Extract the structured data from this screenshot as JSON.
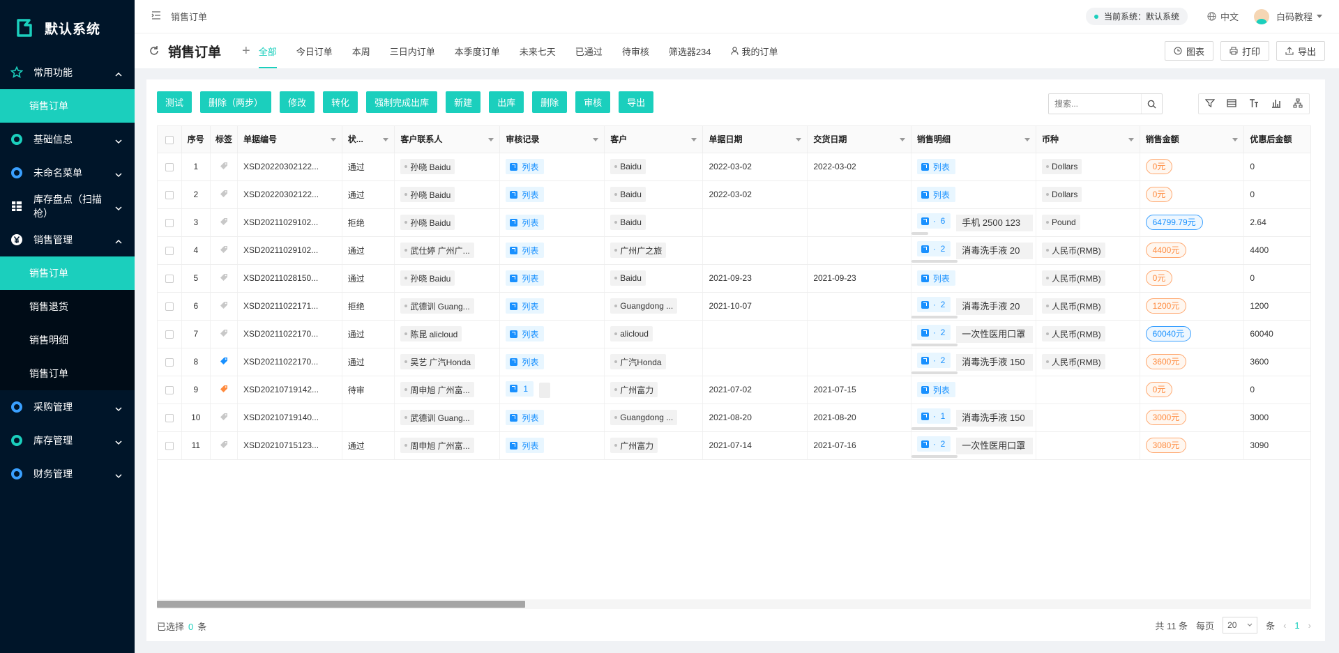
{
  "app": {
    "logo_text": "默认系统",
    "accent": "#1bcfbd",
    "sidebar_bg": "#001529"
  },
  "sidebar": {
    "items": [
      {
        "label": "常用功能",
        "type": "group",
        "icon": "star-icon",
        "expanded": true
      },
      {
        "label": "销售订单",
        "type": "sub",
        "active": true
      },
      {
        "label": "基础信息",
        "type": "group",
        "icon": "ring-icon",
        "expanded": false
      },
      {
        "label": "未命名菜单",
        "type": "group",
        "icon": "ring-icon",
        "expanded": false
      },
      {
        "label": "库存盘点（扫描枪）",
        "type": "group",
        "icon": "grid-icon",
        "expanded": false
      },
      {
        "label": "销售管理",
        "type": "group",
        "icon": "yen-icon",
        "expanded": true
      },
      {
        "label": "销售订单",
        "type": "sub",
        "active": true
      },
      {
        "label": "销售退货",
        "type": "sub",
        "active": false
      },
      {
        "label": "销售明细",
        "type": "sub",
        "active": false
      },
      {
        "label": "销售订单",
        "type": "sub",
        "active": false
      },
      {
        "label": "采购管理",
        "type": "group",
        "icon": "ring-icon",
        "expanded": false
      },
      {
        "label": "库存管理",
        "type": "group",
        "icon": "ring-icon",
        "expanded": false
      },
      {
        "label": "财务管理",
        "type": "group",
        "icon": "ring-icon",
        "expanded": false
      }
    ]
  },
  "topbar": {
    "breadcrumb": "销售订单",
    "current_system": "当前系统：默认系统",
    "language": "中文",
    "user": "白码教程"
  },
  "page": {
    "title": "销售订单",
    "tabs": [
      "全部",
      "今日订单",
      "本周",
      "三日内订单",
      "本季度订单",
      "未来七天",
      "已通过",
      "待审核",
      "筛选器234",
      "我的订单"
    ],
    "active_tab": 0,
    "right_buttons": [
      "图表",
      "打印",
      "导出"
    ]
  },
  "toolbar": {
    "buttons": [
      "测试",
      "删除（两步）",
      "修改",
      "转化",
      "强制完成出库",
      "新建",
      "出库",
      "删除",
      "审核",
      "导出"
    ],
    "search_placeholder": "搜索..."
  },
  "table": {
    "columns": [
      "序号",
      "标签",
      "单据编号",
      "状...",
      "客户联系人",
      "审核记录",
      "客户",
      "单据日期",
      "交货日期",
      "销售明细",
      "币种",
      "销售金额",
      "优惠后金额"
    ],
    "rows": [
      {
        "no": "1",
        "tag": "grey",
        "code": "XSD20220302122...",
        "status": "通过",
        "contact": "孙晓 Baidu",
        "audit": "列表",
        "audit_count": "",
        "customer": "Baidu",
        "date": "2022-03-02",
        "delivery": "2022-03-02",
        "detail_count": "",
        "detail_text": "",
        "currency": "Dollars",
        "amount": "0元",
        "amount_style": "orange",
        "discount": "0"
      },
      {
        "no": "2",
        "tag": "grey",
        "code": "XSD20220302122...",
        "status": "通过",
        "contact": "孙晓 Baidu",
        "audit": "列表",
        "audit_count": "",
        "customer": "Baidu",
        "date": "2022-03-02",
        "delivery": "",
        "detail_count": "",
        "detail_text": "",
        "currency": "Dollars",
        "amount": "0元",
        "amount_style": "orange",
        "discount": "0"
      },
      {
        "no": "3",
        "tag": "grey",
        "code": "XSD20211029102...",
        "status": "拒绝",
        "contact": "孙晓 Baidu",
        "audit": "列表",
        "audit_count": "",
        "customer": "Baidu",
        "date": "",
        "delivery": "",
        "detail_count": "6",
        "detail_text": "手机 2500 123",
        "currency": "Pound",
        "amount": "64799.79元",
        "amount_style": "blue",
        "discount": "2.64"
      },
      {
        "no": "4",
        "tag": "grey",
        "code": "XSD20211029102...",
        "status": "通过",
        "contact": "武仕婷 广州广...",
        "audit": "列表",
        "audit_count": "",
        "customer": "广州广之旅",
        "date": "",
        "delivery": "",
        "detail_count": "2",
        "detail_text": "消毒洗手液 20",
        "currency": "人民币(RMB)",
        "amount": "4400元",
        "amount_style": "orange",
        "discount": "4400"
      },
      {
        "no": "5",
        "tag": "grey",
        "code": "XSD20211028150...",
        "status": "通过",
        "contact": "孙晓 Baidu",
        "audit": "列表",
        "audit_count": "",
        "customer": "Baidu",
        "date": "2021-09-23",
        "delivery": "2021-09-23",
        "detail_count": "",
        "detail_text": "",
        "currency": "人民币(RMB)",
        "amount": "0元",
        "amount_style": "orange",
        "discount": "0"
      },
      {
        "no": "6",
        "tag": "grey",
        "code": "XSD20211022171...",
        "status": "拒绝",
        "contact": "武德训 Guang...",
        "audit": "列表",
        "audit_count": "",
        "customer": "Guangdong ...",
        "date": "2021-10-07",
        "delivery": "",
        "detail_count": "2",
        "detail_text": "消毒洗手液 20",
        "currency": "人民币(RMB)",
        "amount": "1200元",
        "amount_style": "orange",
        "discount": "1200"
      },
      {
        "no": "7",
        "tag": "grey",
        "code": "XSD20211022170...",
        "status": "通过",
        "contact": "陈昆 alicloud",
        "audit": "列表",
        "audit_count": "",
        "customer": "alicloud",
        "date": "",
        "delivery": "",
        "detail_count": "2",
        "detail_text": "一次性医用口罩",
        "currency": "人民币(RMB)",
        "amount": "60040元",
        "amount_style": "blue",
        "discount": "60040"
      },
      {
        "no": "8",
        "tag": "blue",
        "code": "XSD20211022170...",
        "status": "通过",
        "contact": "吴艺 广汽Honda",
        "audit": "列表",
        "audit_count": "",
        "customer": "广汽Honda",
        "date": "",
        "delivery": "",
        "detail_count": "2",
        "detail_text": "消毒洗手液 150",
        "currency": "人民币(RMB)",
        "amount": "3600元",
        "amount_style": "orange",
        "discount": "3600"
      },
      {
        "no": "9",
        "tag": "orange",
        "code": "XSD20210719142...",
        "status": "待审",
        "contact": "周申旭 广州富...",
        "audit": "",
        "audit_count": "1",
        "customer": "广州富力",
        "date": "2021-07-02",
        "delivery": "2021-07-15",
        "detail_count": "",
        "detail_text": "",
        "currency": "",
        "amount": "0元",
        "amount_style": "orange",
        "discount": "0"
      },
      {
        "no": "10",
        "tag": "grey",
        "code": "XSD20210719140...",
        "status": "",
        "contact": "武德训 Guang...",
        "audit": "列表",
        "audit_count": "",
        "customer": "Guangdong ...",
        "date": "2021-08-20",
        "delivery": "2021-08-20",
        "detail_count": "1",
        "detail_text": "消毒洗手液 150",
        "currency": "",
        "amount": "3000元",
        "amount_style": "orange",
        "discount": "3000"
      },
      {
        "no": "11",
        "tag": "grey",
        "code": "XSD20210715123...",
        "status": "通过",
        "contact": "周申旭 广州富...",
        "audit": "列表",
        "audit_count": "",
        "customer": "广州富力",
        "date": "2021-07-14",
        "delivery": "2021-07-16",
        "detail_count": "2",
        "detail_text": "一次性医用口罩",
        "currency": "",
        "amount": "3080元",
        "amount_style": "orange",
        "discount": "3090"
      }
    ]
  },
  "footer": {
    "selected_prefix": "已选择",
    "selected_count": "0",
    "selected_suffix": "条",
    "total": "共 11 条",
    "per_page_label": "每页",
    "per_page": "20",
    "per_page_suffix": "条",
    "current_page": "1"
  }
}
